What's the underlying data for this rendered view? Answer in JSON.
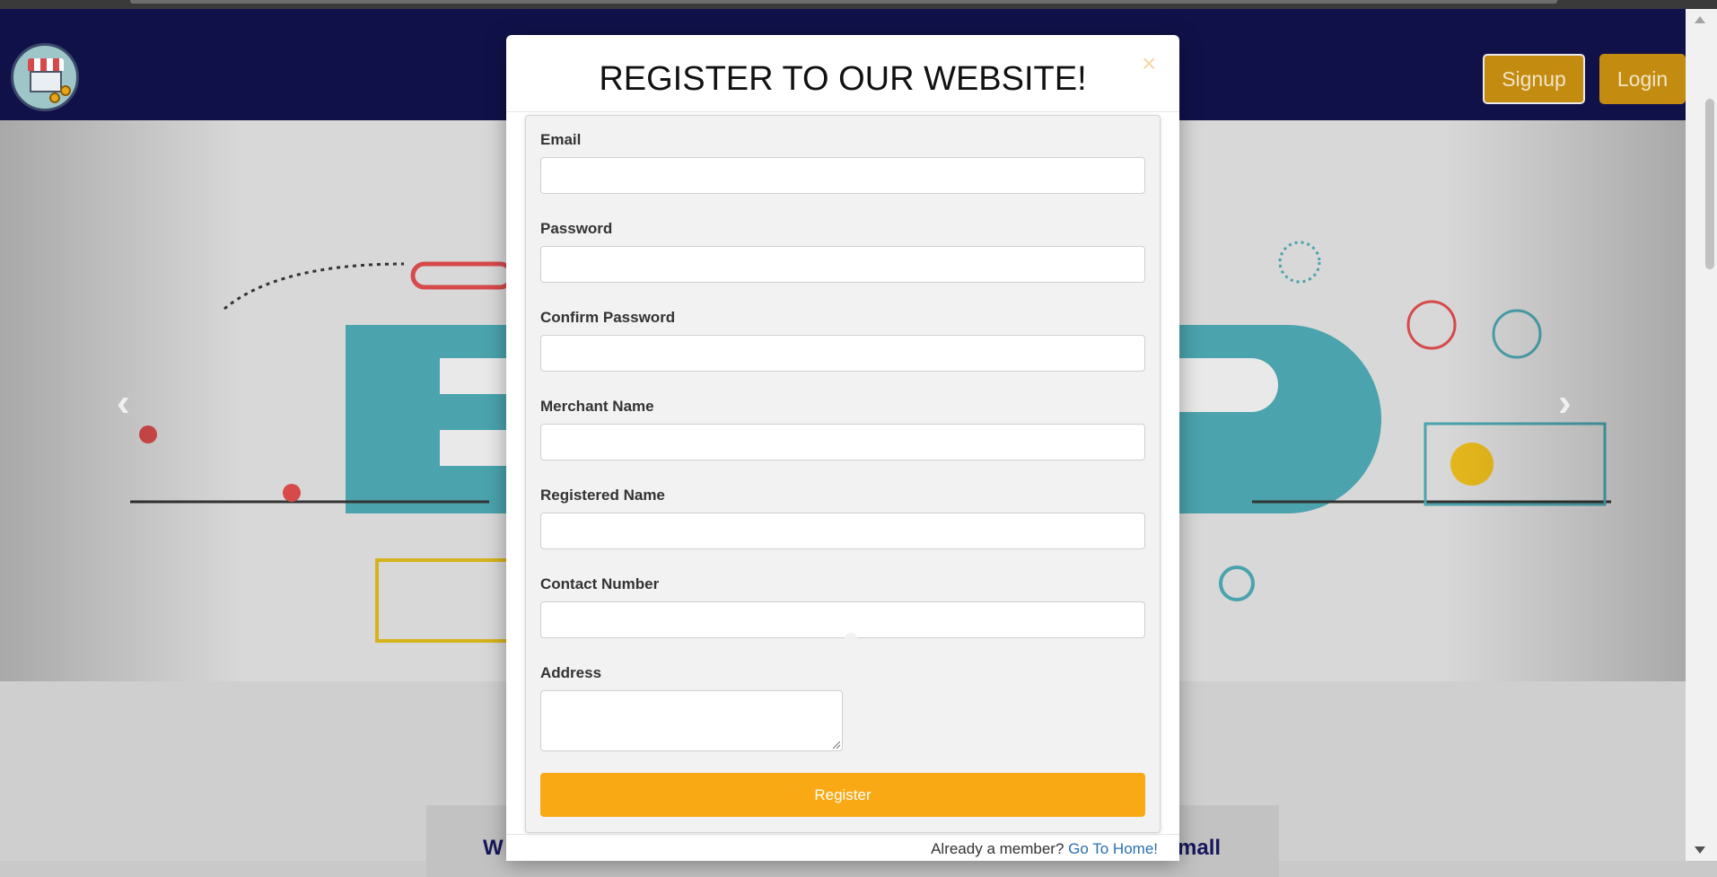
{
  "nav": {
    "signup_label": "Signup",
    "login_label": "Login"
  },
  "modal": {
    "title": "REGISTER TO OUR WEBSITE!",
    "close_glyph": "×",
    "fields": [
      {
        "label": "Email",
        "value": ""
      },
      {
        "label": "Password",
        "value": ""
      },
      {
        "label": "Confirm Password",
        "value": ""
      },
      {
        "label": "Merchant Name",
        "value": ""
      },
      {
        "label": "Registered Name",
        "value": ""
      },
      {
        "label": "Contact Number",
        "value": ""
      },
      {
        "label": "Address",
        "value": ""
      }
    ],
    "register_label": "Register",
    "footer_text": "Already a member?",
    "footer_link": "Go To Home!"
  },
  "carousel": {
    "prev_glyph": "‹",
    "next_glyph": "›"
  },
  "background": {
    "partial_left": "W",
    "partial_right": "mall"
  },
  "colors": {
    "navbar": "#101149",
    "accent": "#f9a914",
    "nav_button": "#c38b0f",
    "link": "#2a6fb0"
  },
  "icons": [
    "logo-icon",
    "close-icon",
    "chevron-left-icon",
    "chevron-right-icon"
  ]
}
